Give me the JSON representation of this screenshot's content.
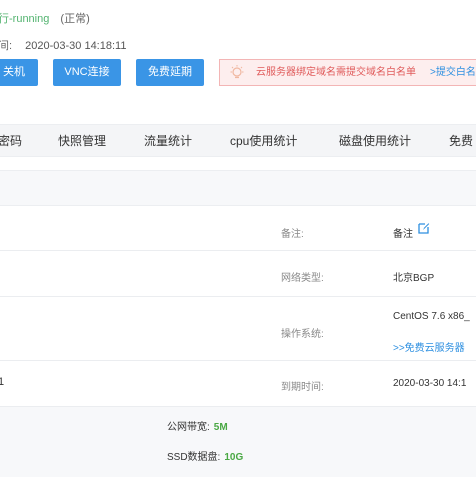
{
  "status": {
    "state_fragment": "行-running",
    "state_note": "(正常)"
  },
  "created": {
    "label_fragment": "间:",
    "time": "2020-03-30 14:18:11"
  },
  "actions": {
    "shutdown": "关机",
    "vnc": "VNC连接",
    "renew": "免费延期"
  },
  "notice": {
    "icon": "lightbulb-icon",
    "text": "云服务器绑定域名需提交域名白名单",
    "link": ">提交白名"
  },
  "tabs": [
    "密码",
    "快照管理",
    "流量统计",
    "cpu使用统计",
    "磁盘使用统计",
    "免费"
  ],
  "info": {
    "remark_label": "备注:",
    "remark_value": "备注",
    "network_label": "网络类型:",
    "network_value": "北京BGP",
    "os_label": "操作系统:",
    "os_value": "CentOS 7.6 x86_",
    "os_link": ">>免费云服务器",
    "expire_label": "到期时间:",
    "expire_value": "2020-03-30 14:1",
    "left_fragment": "1"
  },
  "specs": {
    "bandwidth_label": "公网带宽:",
    "bandwidth_value": "5M",
    "disk_label": "SSD数据盘:",
    "disk_value": "10G"
  },
  "colors": {
    "primary": "#3a95e6",
    "running": "#52b36f",
    "notice_text": "#e05b5b",
    "link": "#2d8fe0",
    "spec_value": "#4aa844"
  }
}
